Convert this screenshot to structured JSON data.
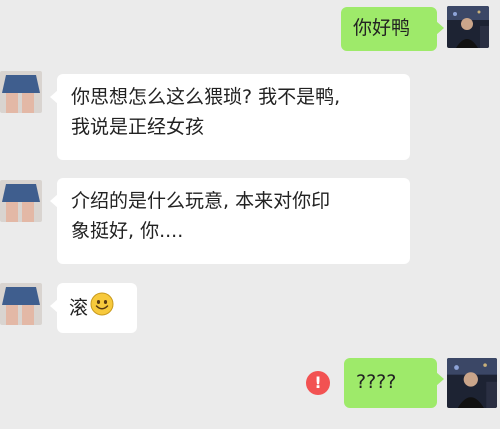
{
  "messages": [
    {
      "side": "out",
      "lines": [
        "你好鸭"
      ]
    },
    {
      "side": "in",
      "lines": [
        "你思想怎么这么猥琐? 我不是鸭,",
        "我说是正经女孩"
      ]
    },
    {
      "side": "in",
      "lines": [
        "介绍的是什么玩意, 本来对你印",
        "象挺好, 你...."
      ]
    },
    {
      "side": "in",
      "lines": [
        "滚"
      ],
      "emoji": "smiling-face-emoji"
    },
    {
      "side": "out",
      "lines": [
        "????"
      ],
      "status": "send-failed"
    }
  ],
  "error_icon_text": "!",
  "colors": {
    "background": "#ebebeb",
    "incoming_bubble": "#ffffff",
    "outgoing_bubble": "#9eea6a",
    "error": "#f25252"
  }
}
